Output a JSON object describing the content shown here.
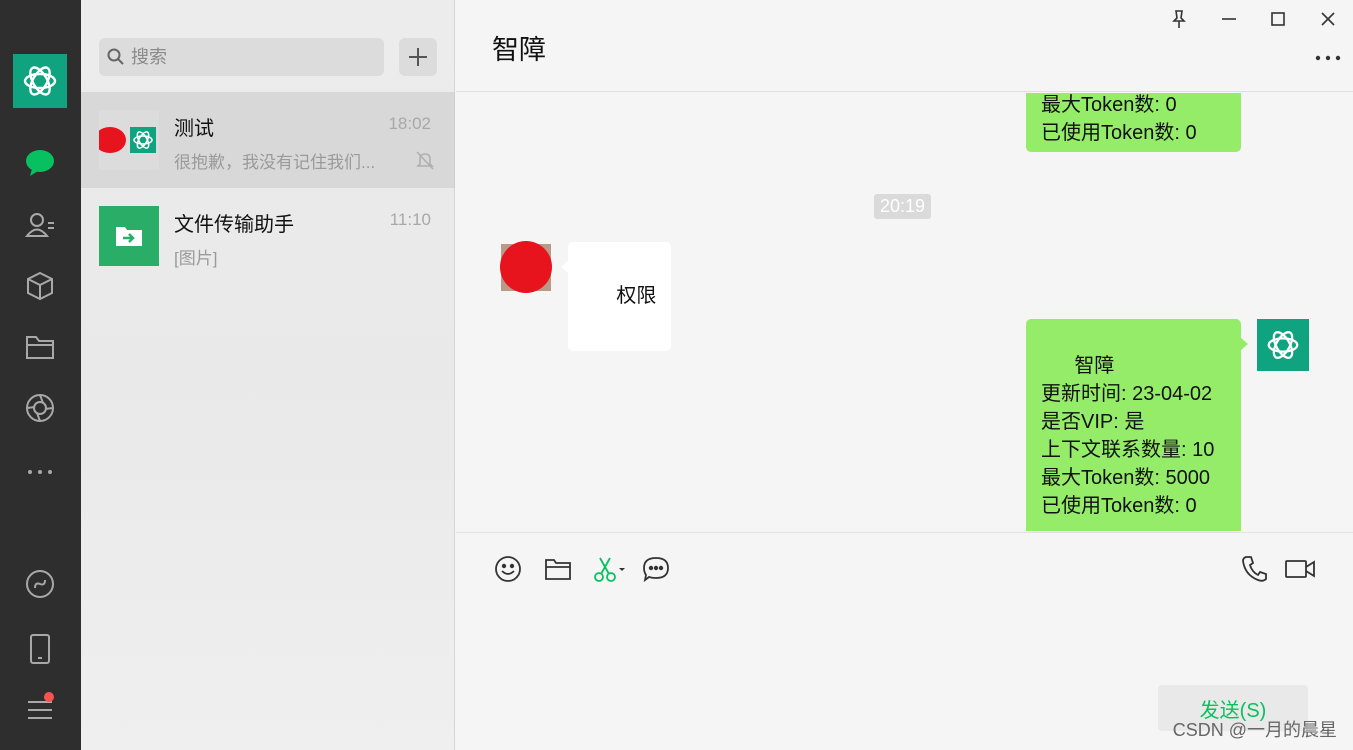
{
  "nav": {
    "icons": [
      "chatgpt-logo-icon",
      "chat-icon",
      "contacts-icon",
      "favorites-icon",
      "files-icon",
      "moments-icon",
      "more-icon",
      "mini-program-icon",
      "phone-icon",
      "menu-icon"
    ]
  },
  "search": {
    "placeholder": "搜索"
  },
  "chats": [
    {
      "name": "测试",
      "time": "18:02",
      "message": "很抱歉，我没有记住我们...",
      "muted": true
    },
    {
      "name": "文件传输助手",
      "time": "11:10",
      "message": "[图片]"
    }
  ],
  "header": {
    "title": "智障"
  },
  "messages": {
    "first_partial": "最大Token数: 0\n已使用Token数: 0",
    "timestamp": "20:19",
    "incoming": "权限",
    "reply": "智障\n更新时间: 23-04-02\n是否VIP: 是\n上下文联系数量: 10\n最大Token数: 5000\n已使用Token数: 0"
  },
  "composer": {
    "send_label": "发送(S)"
  },
  "watermark": "CSDN @一月的晨星",
  "colors": {
    "accent": "#07c160",
    "bubble_self": "#95ec69",
    "nav_bg": "#2e2e2e",
    "logo_bg": "#10a37f",
    "unread_dot": "#fa5151"
  }
}
